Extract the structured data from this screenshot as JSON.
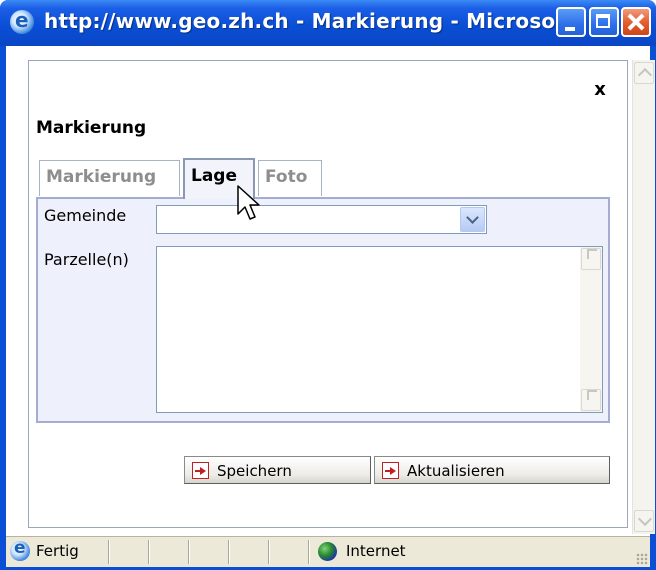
{
  "window": {
    "title": "http://www.geo.zh.ch - Markierung - Microso..."
  },
  "dialog": {
    "title": "Markierung",
    "close_label": "x",
    "tabs": [
      {
        "label": "Markierung",
        "active": false
      },
      {
        "label": "Lage",
        "active": true
      },
      {
        "label": "Foto",
        "active": false
      }
    ],
    "fields": {
      "gemeinde_label": "Gemeinde",
      "gemeinde_value": "",
      "parzellen_label": "Parzelle(n)",
      "parzellen_value": ""
    },
    "buttons": {
      "save_label": "Speichern",
      "update_label": "Aktualisieren"
    }
  },
  "statusbar": {
    "status_text": "Fertig",
    "zone_text": "Internet"
  },
  "icons": {
    "browser": "ie-icon",
    "zone": "globe-icon",
    "button_action": "arrow-right-icon"
  }
}
